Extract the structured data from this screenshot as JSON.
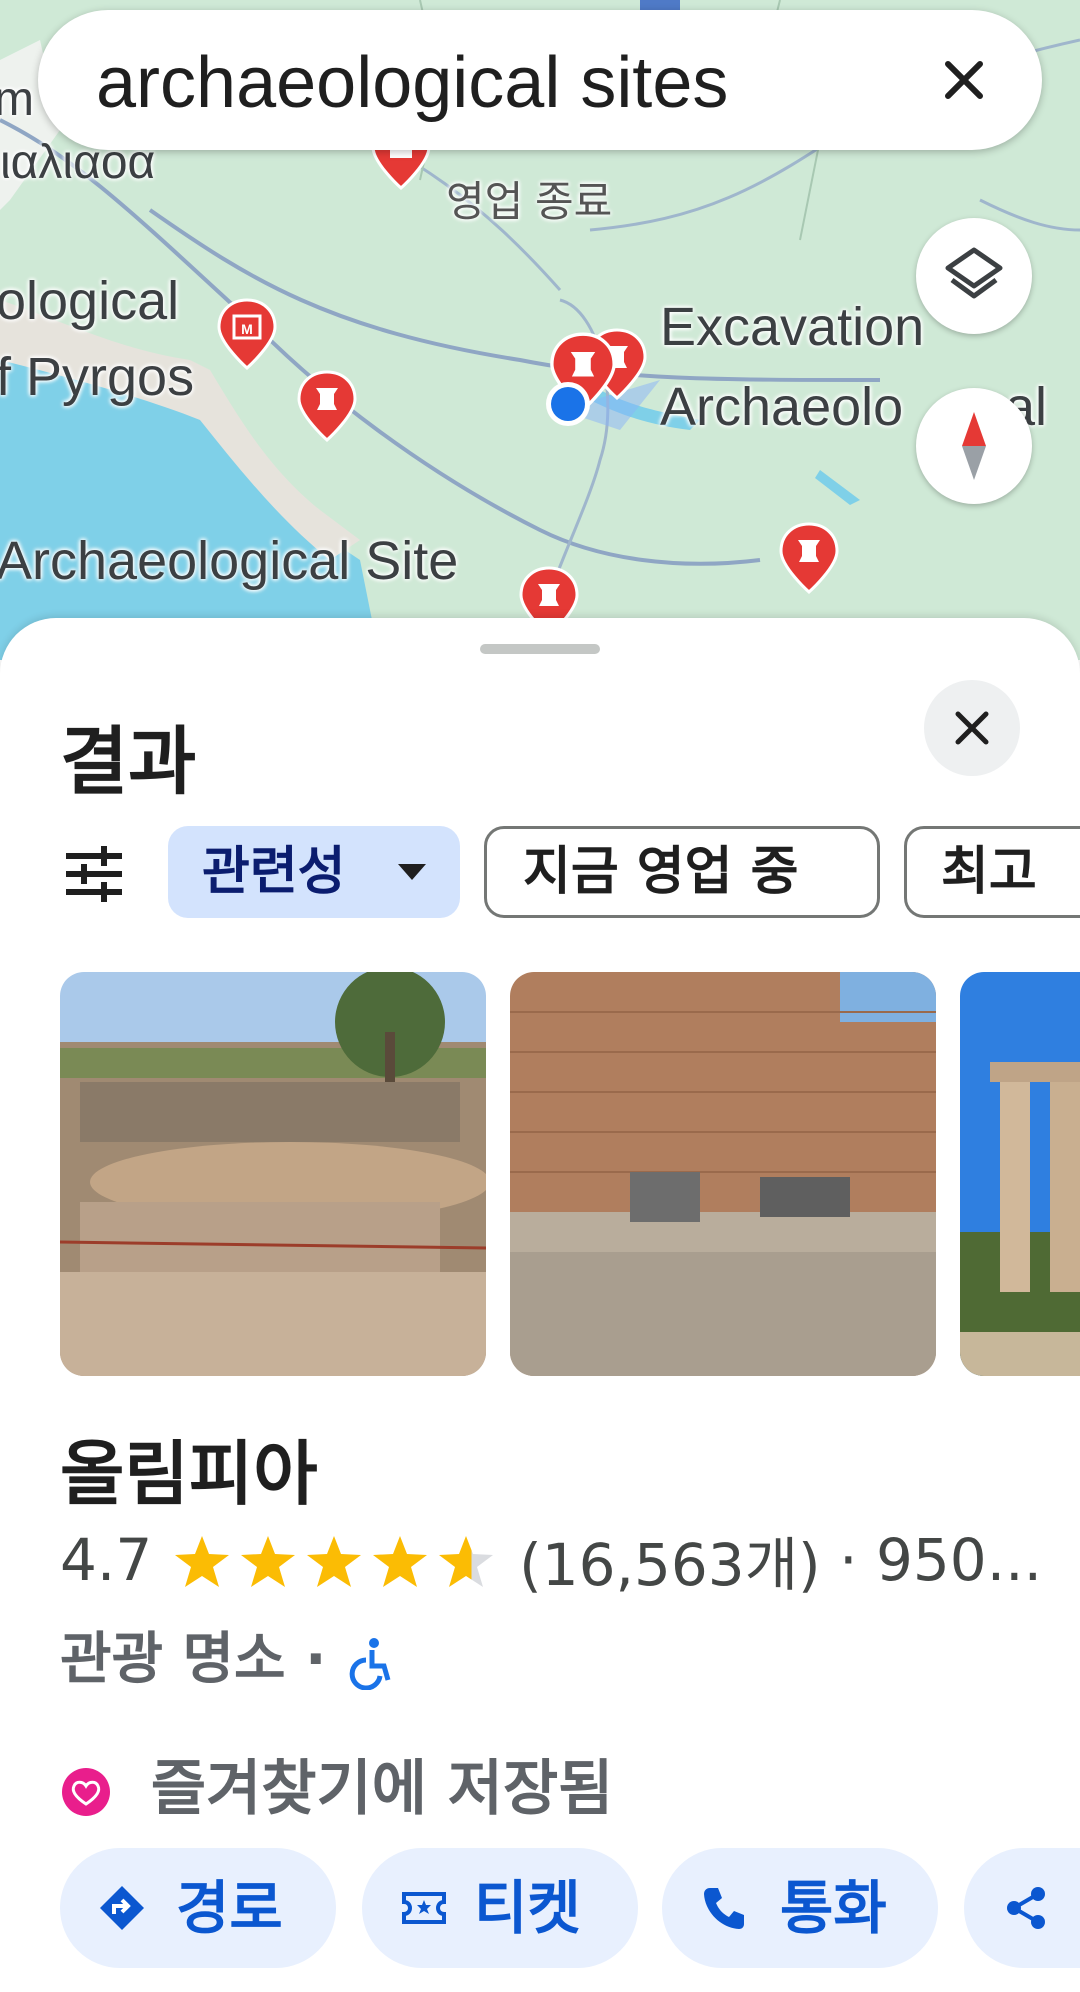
{
  "search": {
    "query": "archaeological sites",
    "clear_icon": "close-icon"
  },
  "map": {
    "labels": {
      "left_top": "m",
      "greek_partial": "ιαλιαοα",
      "ological": "ological",
      "pyrgos": "f Pyrgos",
      "closed": "영업 종료",
      "excavation": "Excavation",
      "archaeol": "Archaeolo",
      "cal": "cal",
      "archaeological_site": "Archaeological Site"
    },
    "layers_icon": "layers-icon",
    "compass_icon": "compass-icon",
    "colors": {
      "pin": "#e53935",
      "museum_pin": "#e53935",
      "location_dot": "#1a73e8",
      "water": "#7fd0e8",
      "land": "#cfe9d6"
    }
  },
  "sheet": {
    "title": "결과",
    "close_icon": "close-icon",
    "filters": {
      "settings_icon": "tune-icon",
      "chips": [
        {
          "label": "관련성",
          "selected": true,
          "dropdown": true
        },
        {
          "label": "지금 영업 중",
          "selected": false
        },
        {
          "label": "최고 ",
          "selected": false
        }
      ]
    },
    "place": {
      "name": "올림피아",
      "rating": "4.7",
      "stars": 4.7,
      "reviews": "(16,563개)",
      "separator": "·",
      "distance": "950...",
      "category": "관광 명소",
      "accessibility_icon": "wheelchair-icon",
      "saved_label": "즐겨찾기에 저장됨",
      "saved_icon": "heart-icon"
    },
    "actions": [
      {
        "label": "경로",
        "icon": "directions-icon"
      },
      {
        "label": "티켓",
        "icon": "ticket-icon"
      },
      {
        "label": "통화",
        "icon": "phone-icon"
      },
      {
        "label": "",
        "icon": "share-icon"
      }
    ]
  }
}
